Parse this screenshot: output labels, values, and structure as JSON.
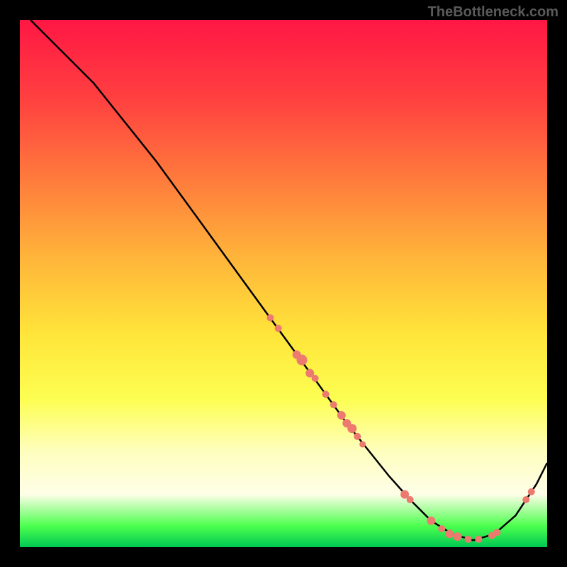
{
  "watermark": "TheBottleneck.com",
  "chart_data": {
    "type": "line",
    "title": "",
    "xlabel": "",
    "ylabel": "",
    "xlim": [
      0,
      100
    ],
    "ylim": [
      0,
      100
    ],
    "gradient_stops": [
      {
        "offset": 0,
        "color": "#ff1744"
      },
      {
        "offset": 15,
        "color": "#ff4040"
      },
      {
        "offset": 30,
        "color": "#ff7a3c"
      },
      {
        "offset": 45,
        "color": "#ffb43a"
      },
      {
        "offset": 60,
        "color": "#ffe63a"
      },
      {
        "offset": 72,
        "color": "#fdfe52"
      },
      {
        "offset": 82,
        "color": "#fefec0"
      },
      {
        "offset": 90,
        "color": "#fefee8"
      },
      {
        "offset": 96,
        "color": "#4CFF4E"
      },
      {
        "offset": 100,
        "color": "#00C853"
      }
    ],
    "series": [
      {
        "name": "curve",
        "type": "line",
        "x": [
          2,
          6,
          10,
          14,
          18,
          22,
          26,
          30,
          34,
          38,
          42,
          46,
          50,
          54,
          58,
          62,
          66,
          70,
          74,
          78,
          82,
          86,
          90,
          94,
          98,
          100
        ],
        "y": [
          100,
          96,
          92,
          88,
          83,
          78,
          73,
          67.5,
          62,
          56.5,
          51,
          45.5,
          40,
          34.5,
          29,
          23.5,
          18.5,
          13.5,
          9,
          5,
          2.5,
          1.3,
          2.5,
          6,
          12,
          16
        ]
      },
      {
        "name": "data-points",
        "type": "scatter",
        "color": "#ed7a6f",
        "points": [
          {
            "x": 47.5,
            "y": 43.5,
            "r": 5
          },
          {
            "x": 49,
            "y": 41.5,
            "r": 5
          },
          {
            "x": 52.5,
            "y": 36.5,
            "r": 6
          },
          {
            "x": 53.5,
            "y": 35.5,
            "r": 7.5
          },
          {
            "x": 55,
            "y": 33,
            "r": 6
          },
          {
            "x": 56,
            "y": 32,
            "r": 5
          },
          {
            "x": 58,
            "y": 29,
            "r": 5
          },
          {
            "x": 59.5,
            "y": 27,
            "r": 5
          },
          {
            "x": 61,
            "y": 25,
            "r": 6
          },
          {
            "x": 62,
            "y": 23.5,
            "r": 6
          },
          {
            "x": 63,
            "y": 22.5,
            "r": 6.5
          },
          {
            "x": 64,
            "y": 21,
            "r": 5
          },
          {
            "x": 65,
            "y": 19.5,
            "r": 4.5
          },
          {
            "x": 73,
            "y": 10,
            "r": 6
          },
          {
            "x": 74,
            "y": 9,
            "r": 5
          },
          {
            "x": 78,
            "y": 5,
            "r": 6
          },
          {
            "x": 80,
            "y": 3.5,
            "r": 5
          },
          {
            "x": 81.5,
            "y": 2.5,
            "r": 6
          },
          {
            "x": 83,
            "y": 2,
            "r": 6
          },
          {
            "x": 85,
            "y": 1.5,
            "r": 5
          },
          {
            "x": 87,
            "y": 1.5,
            "r": 5
          },
          {
            "x": 89.5,
            "y": 2.2,
            "r": 5
          },
          {
            "x": 90.5,
            "y": 2.8,
            "r": 5
          },
          {
            "x": 96,
            "y": 9,
            "r": 5
          },
          {
            "x": 97,
            "y": 10.5,
            "r": 5
          }
        ]
      }
    ]
  }
}
